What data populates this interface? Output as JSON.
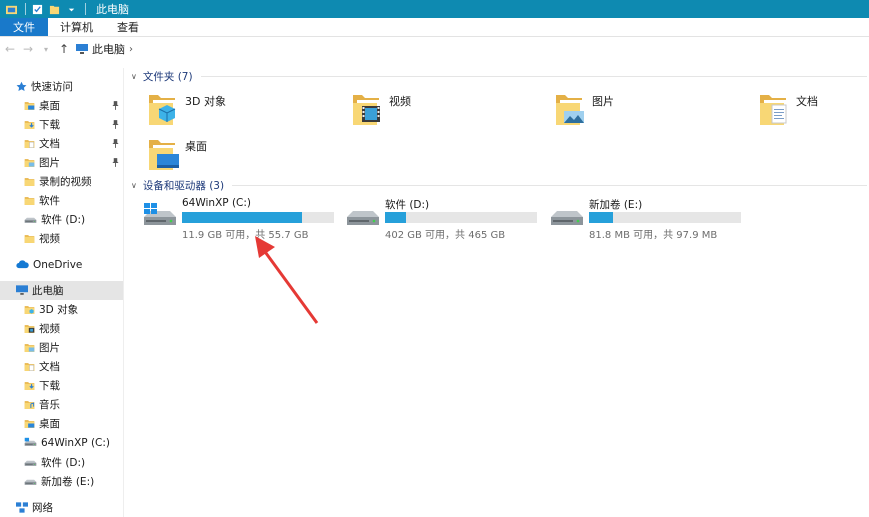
{
  "window": {
    "title": "此电脑"
  },
  "ribbon": {
    "tabs": [
      "文件",
      "计算机",
      "查看"
    ]
  },
  "address": {
    "crumb": "此电脑"
  },
  "sidebar": {
    "items": [
      {
        "label": "快速访问",
        "icon": "star-icon",
        "pinned": false
      },
      {
        "label": "桌面",
        "icon": "desktop-folder-icon",
        "pinned": true
      },
      {
        "label": "下载",
        "icon": "downloads-folder-icon",
        "pinned": true
      },
      {
        "label": "文档",
        "icon": "documents-folder-icon",
        "pinned": true
      },
      {
        "label": "图片",
        "icon": "pictures-folder-icon",
        "pinned": true
      },
      {
        "label": "录制的视频",
        "icon": "folder-icon",
        "pinned": false
      },
      {
        "label": "软件",
        "icon": "folder-icon",
        "pinned": false
      },
      {
        "label": "软件 (D:)",
        "icon": "drive-icon",
        "pinned": false
      },
      {
        "label": "视频",
        "icon": "folder-icon",
        "pinned": false
      },
      {
        "label": "OneDrive",
        "icon": "cloud-icon",
        "pinned": false
      },
      {
        "label": "此电脑",
        "icon": "pc-icon",
        "pinned": false
      },
      {
        "label": "3D 对象",
        "icon": "3d-objects-folder-icon",
        "pinned": false
      },
      {
        "label": "视频",
        "icon": "videos-folder-icon",
        "pinned": false
      },
      {
        "label": "图片",
        "icon": "pictures-folder-icon",
        "pinned": false
      },
      {
        "label": "文档",
        "icon": "documents-folder-icon",
        "pinned": false
      },
      {
        "label": "下载",
        "icon": "downloads-folder-icon",
        "pinned": false
      },
      {
        "label": "音乐",
        "icon": "music-folder-icon",
        "pinned": false
      },
      {
        "label": "桌面",
        "icon": "desktop-folder-icon",
        "pinned": false
      },
      {
        "label": "64WinXP  (C:)",
        "icon": "system-drive-icon",
        "pinned": false
      },
      {
        "label": "软件 (D:)",
        "icon": "drive-icon",
        "pinned": false
      },
      {
        "label": "新加卷 (E:)",
        "icon": "drive-icon",
        "pinned": false
      },
      {
        "label": "网络",
        "icon": "network-icon",
        "pinned": false
      }
    ]
  },
  "folders_group": {
    "title": "文件夹 (7)",
    "items": [
      {
        "label": "3D 对象",
        "icon": "3d-objects-folder-icon"
      },
      {
        "label": "视频",
        "icon": "videos-folder-icon"
      },
      {
        "label": "图片",
        "icon": "pictures-folder-icon"
      },
      {
        "label": "文档",
        "icon": "documents-folder-icon"
      },
      {
        "label": "桌面",
        "icon": "desktop-folder-icon"
      }
    ]
  },
  "drives_group": {
    "title": "设备和驱动器 (3)",
    "items": [
      {
        "name": "64WinXP  (C:)",
        "free_text": "11.9 GB 可用，共 55.7 GB",
        "used_fraction": 0.79,
        "icon": "system-drive-icon"
      },
      {
        "name": "软件 (D:)",
        "free_text": "402 GB 可用，共 465 GB",
        "used_fraction": 0.14,
        "icon": "drive-icon"
      },
      {
        "name": "新加卷 (E:)",
        "free_text": "81.8 MB 可用，共 97.9 MB",
        "used_fraction": 0.16,
        "icon": "drive-icon"
      }
    ]
  },
  "colors": {
    "titlebar": "#0e8ab1",
    "file_tab": "#1979ca",
    "capacity_bar": "#26a0da",
    "annotation_arrow": "#e53935"
  }
}
